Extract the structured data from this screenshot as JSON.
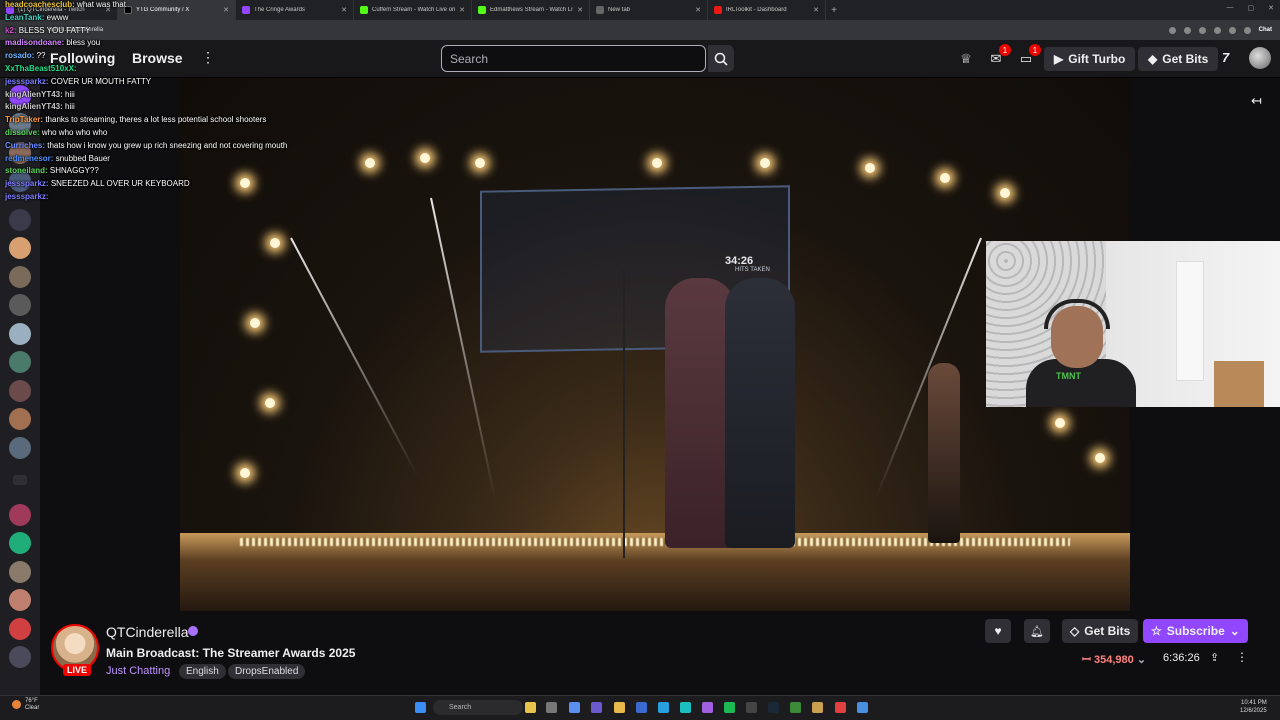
{
  "browser": {
    "tabs": [
      {
        "title": "(1) QTCinderella - Twitch",
        "color": "#9147ff",
        "active": false
      },
      {
        "title": "YTG Community / X",
        "color": "#222222",
        "active": true
      },
      {
        "title": "The Cringe Awards",
        "color": "#9147ff",
        "active": false
      },
      {
        "title": "Cuffem Stream - Watch Live on Ki",
        "color": "#53fc18",
        "active": false
      },
      {
        "title": "Edmatthews Stream - Watch Live",
        "color": "#53fc18",
        "active": false
      },
      {
        "title": "New tab",
        "color": "#888888",
        "active": false
      },
      {
        "title": "IRLToolkit - Dashboard",
        "color": "#e91916",
        "active": false
      }
    ],
    "url": "twitch.tv/qtcinderella",
    "chat_ext": "Chat"
  },
  "topnav": {
    "following": "Following",
    "browse": "Browse",
    "search_placeholder": "Search",
    "inbox_count": "1",
    "whispers_count": "1",
    "gift_turbo": "Gift Turbo",
    "get_bits": "Get Bits",
    "brand": "7"
  },
  "chat": [
    {
      "user": "headcoachesclub:",
      "msg": "what was that",
      "color": "#e8c33a"
    },
    {
      "user": "LeanTank:",
      "msg": "ewww",
      "color": "#3fd6c6"
    },
    {
      "user": "k2:",
      "msg": "BLESS YOU FATTY",
      "color": "#c84cc8"
    },
    {
      "user": "madisondoane:",
      "msg": "bless you",
      "color": "#d68aff"
    },
    {
      "user": "rosado:",
      "msg": "??",
      "color": "#6fb3ff"
    },
    {
      "user": "XxThaBeast510xX:",
      "msg": "",
      "color": "#22e08a"
    },
    {
      "user": "jesssparkz:",
      "msg": "COVER UR MOUTH FATTY",
      "color": "#7c7cff"
    },
    {
      "user": "kingAlienYT43:",
      "msg": "hiii",
      "color": "#c8c8c8"
    },
    {
      "user": "kingAlienYT43:",
      "msg": "hiii",
      "color": "#c8c8c8"
    },
    {
      "user": "TripTaker:",
      "msg": "thanks to streaming, theres a lot less potential school shooters",
      "color": "#ff9a3c"
    },
    {
      "user": "dissolve:",
      "msg": "who who who who",
      "color": "#5cd65c"
    },
    {
      "user": "Curriches:",
      "msg": "thats how i know you grew up rich sneezing and not covering mouth",
      "color": "#6c8cff"
    },
    {
      "user": "redmenesor:",
      "msg": "snubbed Bauer",
      "color": "#4a90ff"
    },
    {
      "user": "stoneiland:",
      "msg": "SHNAGGY??",
      "color": "#5cd65c"
    },
    {
      "user": "jesssparkz:",
      "msg": "SNEEZED ALL OVER UR KEYBOARD",
      "color": "#7c7cff"
    },
    {
      "user": "jesssparkz:",
      "msg": "",
      "color": "#7c7cff"
    }
  ],
  "video": {
    "screen_timer": "34:26",
    "screen_sub": "HITS TAKEN"
  },
  "channel": {
    "name": "QTCinderella",
    "live_label": "LIVE",
    "title": "Main Broadcast: The Streamer Awards 2025",
    "category": "Just Chatting",
    "tags": [
      "English",
      "DropsEnabled"
    ],
    "get_bits": "Get Bits",
    "subscribe": "Subscribe",
    "viewers": "354,980",
    "uptime": "6:36:26"
  },
  "taskbar": {
    "weather_temp": "76°F",
    "weather_desc": "Clear",
    "search": "Search",
    "time": "10:41 PM",
    "date": "12/6/2025"
  },
  "colors": {
    "twitch_purple": "#9147ff",
    "live_red": "#eb0400",
    "bg": "#0e0e10"
  }
}
